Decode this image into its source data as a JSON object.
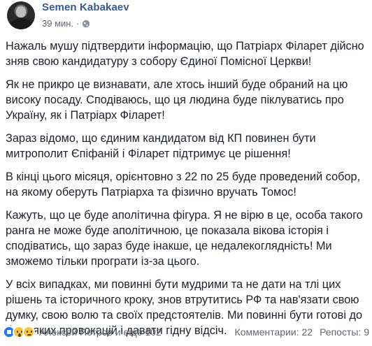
{
  "post": {
    "author": "Semen Kabakaev",
    "time": "39 мин.",
    "separator": "·",
    "paragraphs": [
      "Нажаль мушу підтвердити інформацію, що Патріарх Філарет дійсно зняв свою кандидатуру з собору Єдиної Помісної Церкви!",
      "Як не прикро це визнавати, але хтось інший буде обраний на цю високу посаду. Сподіваюсь, що ця людина буде піклуватись про Україну, як і Патріарх Філарет!",
      "Зараз відомо, що єдиним кандидатом від КП повинен бути митрополит Єпіфаній і Філарет підтримує це рішення!",
      "В кінці цього місяця, орієнтовно з 22 по 25 буде проведений собор, на якому оберуть Патріарха та фізично вручать Томос!",
      "Кажуть, що це буде аполітична фігура. Я не вірю в це, особа такого ранга не може буде аполітичною, це показала вікова історія і сподіватись, що зараз буде інакше, це недалекоглядність! Ми зможемо тільки програти із-за цього.",
      "У всіх випадках, ми повинні бути мудрими та не дати на тлі цих рішень та історичного кроку, знов втрутитись РФ та нав'язати свою думку, свою волю та своїх предстоятелів. Ми повинні бути готові до будь яких провокацій і давати гідну відсіч."
    ]
  },
  "footer": {
    "reactions": [
      "like",
      "wow",
      "sad"
    ],
    "reacted_by": "Алексей Петров и ещё 102",
    "comments": "Комментарии: 22",
    "shares": "Репосты: 9"
  },
  "icons": {
    "avatar": "avatar",
    "privacy": "globe-icon"
  }
}
